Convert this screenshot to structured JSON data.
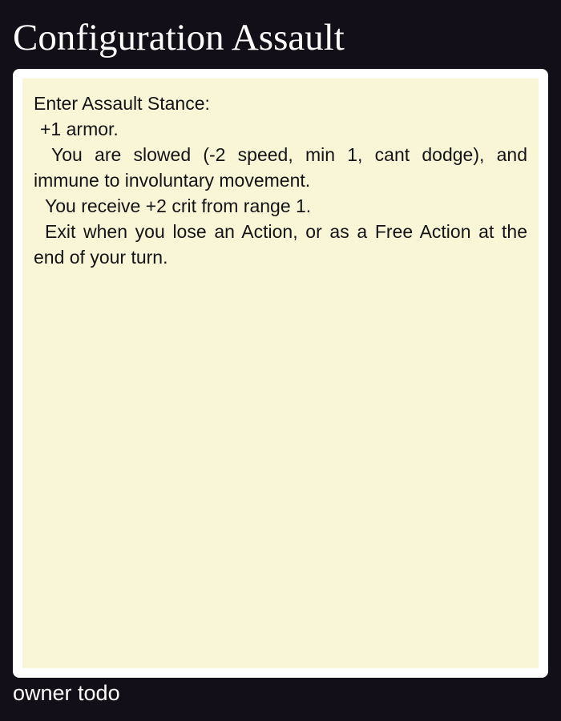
{
  "card": {
    "title": "Configuration Assault",
    "body": {
      "heading": "Enter Assault Stance:",
      "lines": [
        "+1 armor.",
        "You are slowed (-2 speed, min 1, cant dodge), and immune to involuntary movement.",
        "You receive +2 crit from range 1.",
        "Exit when you lose an Action, or as a Free Action at the end of your turn."
      ]
    },
    "footer": "owner todo"
  },
  "colors": {
    "page_background": "#120f18",
    "frame": "#ffffff",
    "body_background": "#f9f5d7",
    "title_text": "#ffffff",
    "body_text": "#141414"
  }
}
